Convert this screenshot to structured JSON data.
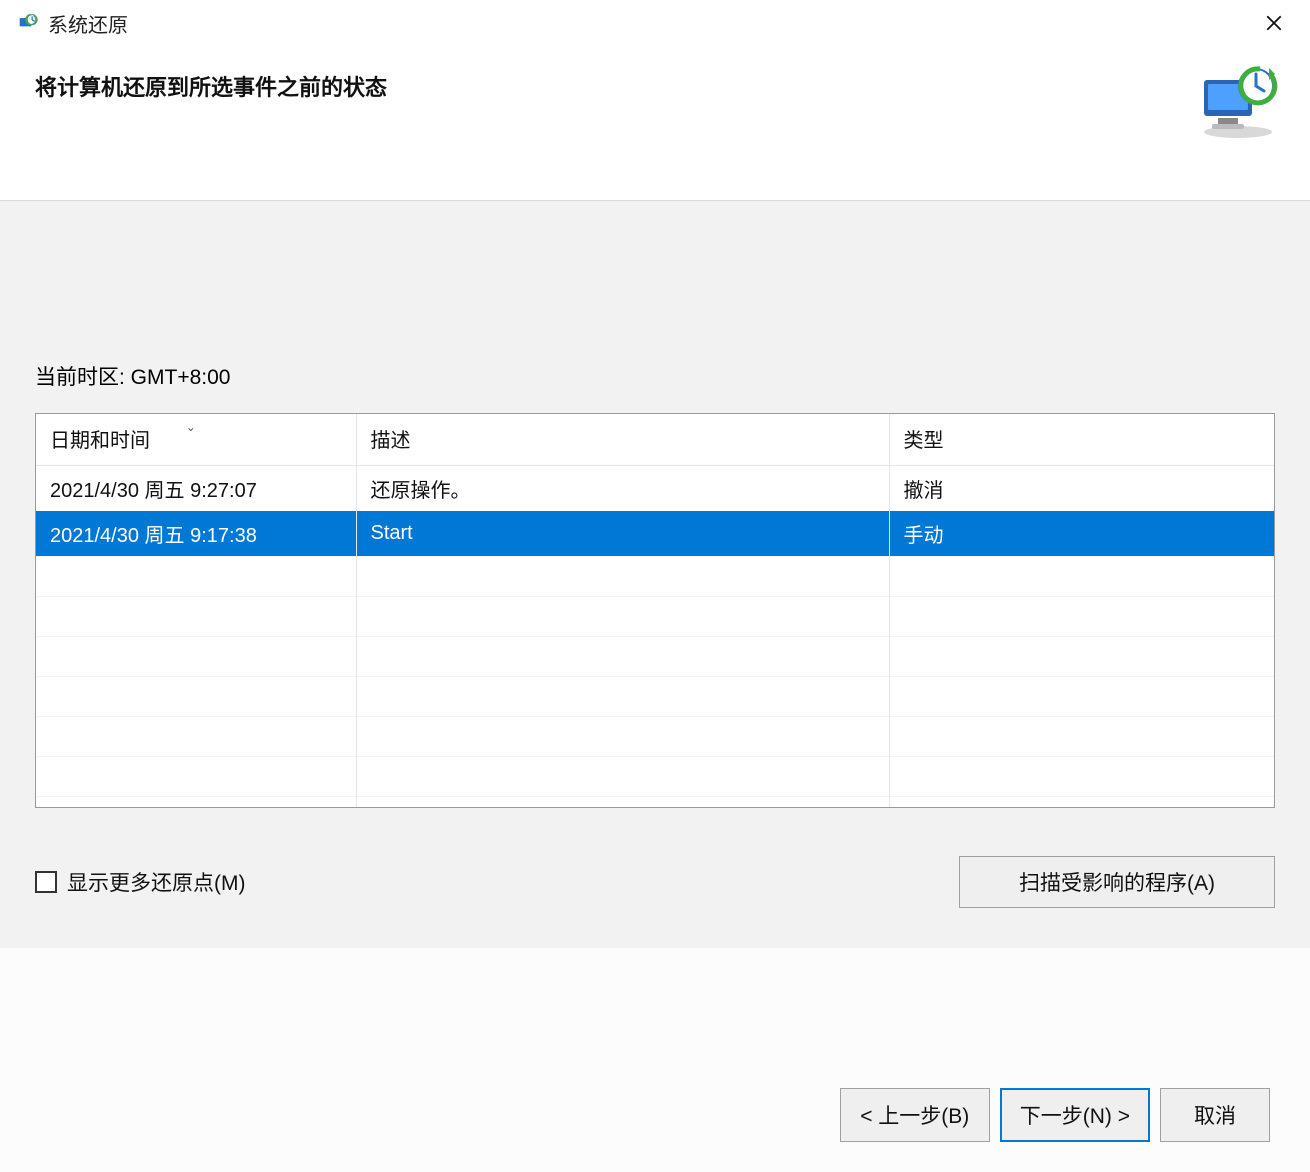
{
  "titlebar": {
    "title": "系统还原"
  },
  "header": {
    "heading": "将计算机还原到所选事件之前的状态"
  },
  "content": {
    "timezone_label": "当前时区: GMT+8:00",
    "columns": {
      "datetime": "日期和时间",
      "description": "描述",
      "type": "类型"
    },
    "rows": [
      {
        "datetime": "2021/4/30 周五 9:27:07",
        "description": "还原操作。",
        "type": "撤消",
        "selected": false
      },
      {
        "datetime": "2021/4/30 周五 9:17:38",
        "description": "Start",
        "type": "手动",
        "selected": true
      }
    ],
    "show_more_label": "显示更多还原点(M)",
    "scan_affected_label": "扫描受影响的程序(A)"
  },
  "footer": {
    "back": "< 上一步(B)",
    "next": "下一步(N) >",
    "cancel": "取消"
  }
}
